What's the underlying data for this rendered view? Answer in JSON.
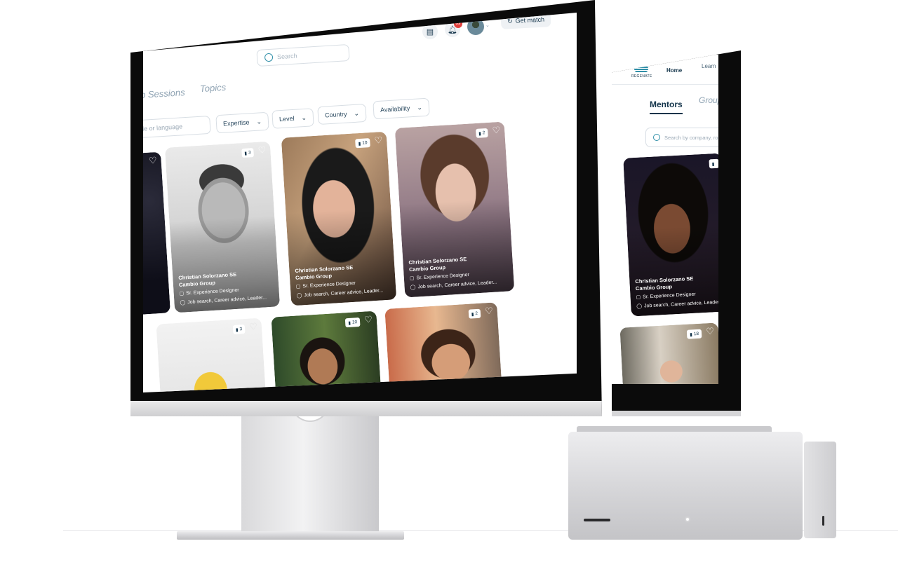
{
  "main_app": {
    "search_placeholder": "Search",
    "notification_count": "99",
    "get_match_label": "Get match",
    "tabs": [
      "p Sessions",
      "Topics"
    ],
    "search_filter_placeholder": "le or language",
    "filters": [
      "Expertise",
      "Level",
      "Country",
      "Availability"
    ],
    "cards": [
      {
        "count": "",
        "name": "",
        "company": "",
        "role": "",
        "interests": "",
        "photo": "dark"
      },
      {
        "count": "3",
        "name": "Christian Solorzano   SE",
        "company": "Cambio Group",
        "role": "Sr. Experience Designer",
        "interests": "Job search, Career advice, Leader...",
        "photo": "bw"
      },
      {
        "count": "10",
        "name": "Christian Solorzano   SE",
        "company": "Cambio Group",
        "role": "Sr. Experience Designer",
        "interests": "Job search, Career advice, Leader...",
        "photo": "freckles"
      },
      {
        "count": "2",
        "name": "Christian Solorzano   SE",
        "company": "Cambio Group",
        "role": "Sr. Experience Designer",
        "interests": "Job search, Career advice, Leader...",
        "photo": "mauve"
      },
      {
        "count": "3",
        "name": "",
        "company": "",
        "role": "",
        "interests": "",
        "photo": "yellow"
      },
      {
        "count": "10",
        "name": "",
        "company": "",
        "role": "",
        "interests": "",
        "photo": "green"
      },
      {
        "count": "2",
        "name": "",
        "company": "",
        "role": "",
        "interests": "",
        "photo": "warm"
      }
    ]
  },
  "second_app": {
    "brand_name": "REGENATE",
    "nav": [
      "Home",
      "Learn"
    ],
    "tabs": [
      "Mentors",
      "Group"
    ],
    "search_placeholder": "Search by company, ro",
    "cards": [
      {
        "count": "",
        "name": "Christian Solorzano   SE",
        "company": "Cambio Group",
        "role": "Sr. Experience Designer",
        "interests": "Job search, Career advice, Leader...",
        "photo": "dark"
      },
      {
        "count": "18",
        "name": "",
        "company": "",
        "role": "",
        "interests": "",
        "photo": "house"
      }
    ]
  },
  "colors": {
    "primary": "#13344a",
    "accent": "#2f8fa8",
    "badge": "#e0403d",
    "border": "#d8dee4",
    "muted": "#8fa3b3"
  },
  "icons": [
    "search-icon",
    "chat-icon",
    "bell-icon",
    "avatar",
    "refresh-icon",
    "chevron-down-icon",
    "bookmark-icon",
    "heart-icon",
    "briefcase-icon",
    "message-icon"
  ]
}
